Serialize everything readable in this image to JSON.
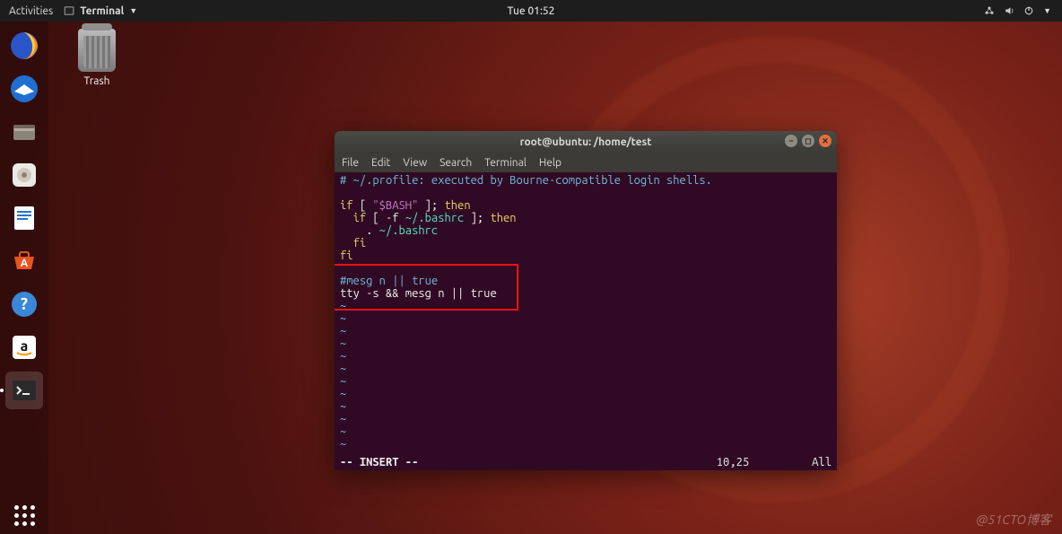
{
  "topbar": {
    "activities": "Activities",
    "app_name": "Terminal",
    "clock": "Tue 01:52"
  },
  "desktop": {
    "trash_label": "Trash"
  },
  "window": {
    "title": "root@ubuntu: /home/test",
    "menu": {
      "file": "File",
      "edit": "Edit",
      "view": "View",
      "search": "Search",
      "terminal": "Terminal",
      "help": "Help"
    },
    "editor": {
      "lines": [
        {
          "type": "comment",
          "text": "# ~/.profile: executed by Bourne-compatible login shells."
        },
        {
          "type": "blank",
          "text": ""
        },
        {
          "type": "code",
          "text": "if [ \"$BASH\" ]; then"
        },
        {
          "type": "code",
          "text": "  if [ -f ~/.bashrc ]; then"
        },
        {
          "type": "code",
          "text": "    . ~/.bashrc"
        },
        {
          "type": "code",
          "text": "  fi"
        },
        {
          "type": "code",
          "text": "fi"
        },
        {
          "type": "blank",
          "text": ""
        },
        {
          "type": "comment",
          "text": "#mesg n || true"
        },
        {
          "type": "code",
          "text": "tty -s && mesg n || true"
        }
      ],
      "tilde_rows": 13,
      "highlight_lines": [
        8,
        9
      ]
    },
    "status": {
      "mode": "-- INSERT --",
      "pos": "10,25",
      "scroll": "All"
    }
  },
  "watermark": "@51CTO博客"
}
